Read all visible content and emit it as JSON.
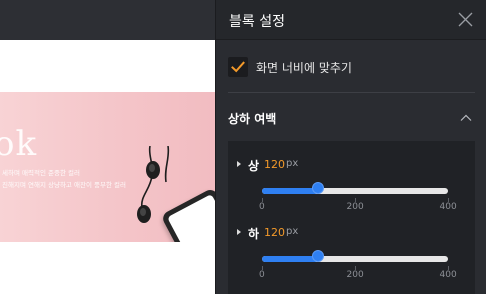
{
  "canvas": {
    "banner_word": "ok",
    "banner_line_1": "세하며 매력적인 준중한 컬러",
    "banner_line_2": "진해지며 연해지 상냥하고 애잔이 풍부한 컬러"
  },
  "panel": {
    "title": "블록 설정",
    "fit_to_screen": {
      "label": "화면 너비에 맞추기",
      "checked": true
    },
    "section": {
      "title": "상하 여백",
      "expanded": true,
      "sliders": [
        {
          "name": "상",
          "value": "120",
          "unit": "px",
          "min": 0,
          "max": 400,
          "ticks": [
            "0",
            "200",
            "400"
          ]
        },
        {
          "name": "하",
          "value": "120",
          "unit": "px",
          "min": 0,
          "max": 400,
          "ticks": [
            "0",
            "200",
            "400"
          ]
        }
      ]
    }
  },
  "colors": {
    "accent": "#2f80f2",
    "value_highlight": "#f39a2a",
    "checkbox_check": "#f39a2a",
    "panel_background": "#2a2c31"
  },
  "icons": {
    "close": "close-icon",
    "checkbox": "checkmark-icon",
    "section_toggle": "chevron-up-icon"
  }
}
